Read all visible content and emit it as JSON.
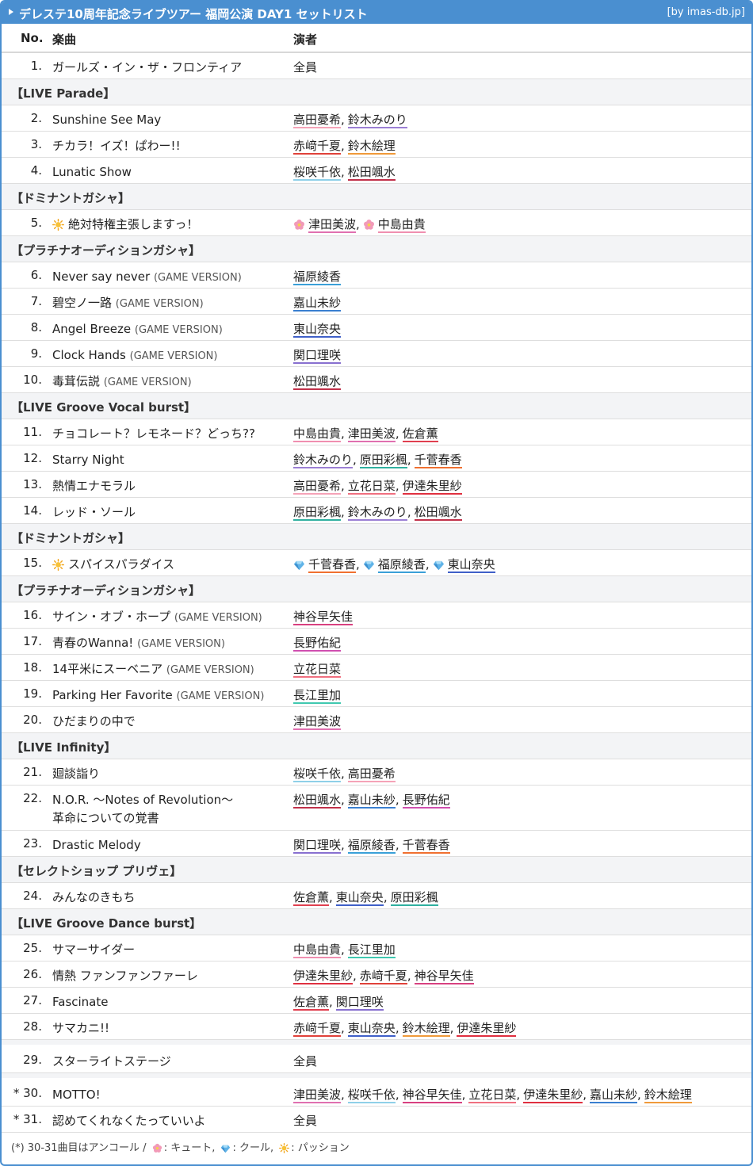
{
  "header": {
    "title": "デレステ10周年記念ライブツアー 福岡公演 DAY1 セットリスト",
    "credit": "[by imas-db.jp]"
  },
  "columns": {
    "no": "No.",
    "song": "楽曲",
    "performers": "演者"
  },
  "colors": {
    "titlebar": "#4a8fd0",
    "高田憂希": "#f5a3b8",
    "鈴木みのり": "#9b7fd4",
    "赤﨑千夏": "#e0413a",
    "鈴木絵理": "#f09a3a",
    "桜咲千依": "#8fd0e8",
    "松田颯水": "#c0314a",
    "津田美波": "#e070b0",
    "中島由貴": "#f08fb0",
    "福原綾香": "#3aa0d8",
    "嘉山未紗": "#3a7fd0",
    "東山奈央": "#4060c8",
    "関口理咲": "#8870d0",
    "佐倉薫": "#e04050",
    "原田彩楓": "#30b0a0",
    "千菅春香": "#f07030",
    "立花日菜": "#f07080",
    "伊達朱里紗": "#e03040",
    "神谷早矢佳": "#d84080",
    "長野佑紀": "#d050b0",
    "長江里加": "#40c8b0"
  },
  "rows": [
    {
      "type": "song",
      "no": "1.",
      "title": "ガールズ・イン・ザ・フロンティア",
      "performers": [
        {
          "name": "全員",
          "plain": true
        }
      ]
    },
    {
      "type": "section",
      "label": "【LIVE Parade】"
    },
    {
      "type": "song",
      "no": "2.",
      "title": "Sunshine See May",
      "performers": [
        {
          "name": "高田憂希"
        },
        {
          "name": "鈴木みのり"
        }
      ]
    },
    {
      "type": "song",
      "no": "3.",
      "title": "チカラ！イズ！ぱわー!!",
      "performers": [
        {
          "name": "赤﨑千夏"
        },
        {
          "name": "鈴木絵理"
        }
      ]
    },
    {
      "type": "song",
      "no": "4.",
      "title": "Lunatic Show",
      "performers": [
        {
          "name": "桜咲千依"
        },
        {
          "name": "松田颯水"
        }
      ]
    },
    {
      "type": "section",
      "label": "【ドミナントガシャ】"
    },
    {
      "type": "song",
      "no": "5.",
      "title": "絶対特権主張しますっ！",
      "icon": "passion-sun-icon",
      "performers": [
        {
          "name": "津田美波",
          "icon": "cute"
        },
        {
          "name": "中島由貴",
          "icon": "cute"
        }
      ]
    },
    {
      "type": "section",
      "label": "【プラチナオーディションガシャ】"
    },
    {
      "type": "song",
      "no": "6.",
      "title": "Never say never",
      "version": "(GAME VERSION)",
      "performers": [
        {
          "name": "福原綾香"
        }
      ]
    },
    {
      "type": "song",
      "no": "7.",
      "title": "碧空ノ一路",
      "version": "(GAME VERSION)",
      "performers": [
        {
          "name": "嘉山未紗"
        }
      ]
    },
    {
      "type": "song",
      "no": "8.",
      "title": "Angel Breeze",
      "version": "(GAME VERSION)",
      "performers": [
        {
          "name": "東山奈央"
        }
      ]
    },
    {
      "type": "song",
      "no": "9.",
      "title": "Clock Hands",
      "version": "(GAME VERSION)",
      "performers": [
        {
          "name": "関口理咲"
        }
      ]
    },
    {
      "type": "song",
      "no": "10.",
      "title": "毒茸伝説",
      "version": "(GAME VERSION)",
      "performers": [
        {
          "name": "松田颯水"
        }
      ]
    },
    {
      "type": "section",
      "label": "【LIVE Groove Vocal burst】"
    },
    {
      "type": "song",
      "no": "11.",
      "title": "チョコレート？レモネード？どっち??",
      "performers": [
        {
          "name": "中島由貴"
        },
        {
          "name": "津田美波"
        },
        {
          "name": "佐倉薫"
        }
      ]
    },
    {
      "type": "song",
      "no": "12.",
      "title": "Starry Night",
      "performers": [
        {
          "name": "鈴木みのり"
        },
        {
          "name": "原田彩楓"
        },
        {
          "name": "千菅春香"
        }
      ]
    },
    {
      "type": "song",
      "no": "13.",
      "title": "熱情エナモラル",
      "performers": [
        {
          "name": "高田憂希"
        },
        {
          "name": "立花日菜"
        },
        {
          "name": "伊達朱里紗"
        }
      ]
    },
    {
      "type": "song",
      "no": "14.",
      "title": "レッド・ソール",
      "performers": [
        {
          "name": "原田彩楓"
        },
        {
          "name": "鈴木みのり"
        },
        {
          "name": "松田颯水"
        }
      ]
    },
    {
      "type": "section",
      "label": "【ドミナントガシャ】"
    },
    {
      "type": "song",
      "no": "15.",
      "title": "スパイスパラダイス",
      "icon": "passion-sun-icon",
      "performers": [
        {
          "name": "千菅春香",
          "icon": "cool"
        },
        {
          "name": "福原綾香",
          "icon": "cool"
        },
        {
          "name": "東山奈央",
          "icon": "cool"
        }
      ]
    },
    {
      "type": "section",
      "label": "【プラチナオーディションガシャ】"
    },
    {
      "type": "song",
      "no": "16.",
      "title": "サイン・オブ・ホープ",
      "version": "(GAME VERSION)",
      "performers": [
        {
          "name": "神谷早矢佳"
        }
      ]
    },
    {
      "type": "song",
      "no": "17.",
      "title": "青春のWanna!",
      "version": "(GAME VERSION)",
      "performers": [
        {
          "name": "長野佑紀"
        }
      ]
    },
    {
      "type": "song",
      "no": "18.",
      "title": "14平米にスーベニア",
      "version": "(GAME VERSION)",
      "performers": [
        {
          "name": "立花日菜"
        }
      ]
    },
    {
      "type": "song",
      "no": "19.",
      "title": "Parking Her Favorite",
      "version": "(GAME VERSION)",
      "performers": [
        {
          "name": "長江里加"
        }
      ]
    },
    {
      "type": "song",
      "no": "20.",
      "title": "ひだまりの中で",
      "performers": [
        {
          "name": "津田美波"
        }
      ]
    },
    {
      "type": "section",
      "label": "【LIVE Infinity】"
    },
    {
      "type": "song",
      "no": "21.",
      "title": "廻談詣り",
      "performers": [
        {
          "name": "桜咲千依"
        },
        {
          "name": "高田憂希"
        }
      ]
    },
    {
      "type": "song",
      "no": "22.",
      "title": "N.O.R. ～Notes of Revolution～",
      "title2": "革命についての覚書",
      "tall": true,
      "performers": [
        {
          "name": "松田颯水"
        },
        {
          "name": "嘉山未紗"
        },
        {
          "name": "長野佑紀"
        }
      ]
    },
    {
      "type": "song",
      "no": "23.",
      "title": "Drastic Melody",
      "performers": [
        {
          "name": "関口理咲"
        },
        {
          "name": "福原綾香"
        },
        {
          "name": "千菅春香"
        }
      ]
    },
    {
      "type": "section",
      "label": "【セレクトショップ プリヴェ】"
    },
    {
      "type": "song",
      "no": "24.",
      "title": "みんなのきもち",
      "performers": [
        {
          "name": "佐倉薫"
        },
        {
          "name": "東山奈央"
        },
        {
          "name": "原田彩楓"
        }
      ]
    },
    {
      "type": "section",
      "label": "【LIVE Groove Dance burst】"
    },
    {
      "type": "song",
      "no": "25.",
      "title": "サマーサイダー",
      "performers": [
        {
          "name": "中島由貴"
        },
        {
          "name": "長江里加"
        }
      ]
    },
    {
      "type": "song",
      "no": "26.",
      "title": "情熱 ファンファンファーレ",
      "performers": [
        {
          "name": "伊達朱里紗"
        },
        {
          "name": "赤﨑千夏"
        },
        {
          "name": "神谷早矢佳"
        }
      ]
    },
    {
      "type": "song",
      "no": "27.",
      "title": "Fascinate",
      "performers": [
        {
          "name": "佐倉薫"
        },
        {
          "name": "関口理咲"
        }
      ]
    },
    {
      "type": "song",
      "no": "28.",
      "title": "サマカニ!!",
      "performers": [
        {
          "name": "赤﨑千夏"
        },
        {
          "name": "東山奈央"
        },
        {
          "name": "鈴木絵理"
        },
        {
          "name": "伊達朱里紗"
        }
      ]
    },
    {
      "type": "song",
      "no": "29.",
      "title": "スターライトステージ",
      "gap": true,
      "tall2": true,
      "performers": [
        {
          "name": "全員",
          "plain": true
        }
      ]
    },
    {
      "type": "song",
      "no": "* 30.",
      "title": "MOTTO!",
      "gap": true,
      "tall2": true,
      "performers": [
        {
          "name": "津田美波"
        },
        {
          "name": "桜咲千依"
        },
        {
          "name": "神谷早矢佳"
        },
        {
          "name": "立花日菜"
        },
        {
          "name": "伊達朱里紗"
        },
        {
          "name": "嘉山未紗"
        },
        {
          "name": "鈴木絵理"
        }
      ]
    },
    {
      "type": "song",
      "no": "* 31.",
      "title": "認めてくれなくたっていいよ",
      "performers": [
        {
          "name": "全員",
          "plain": true
        }
      ]
    }
  ],
  "footnote": {
    "encore": "(*) 30-31曲目はアンコール /",
    "cute": ": キュート,",
    "cool": ": クール,",
    "passion": ": パッション"
  }
}
